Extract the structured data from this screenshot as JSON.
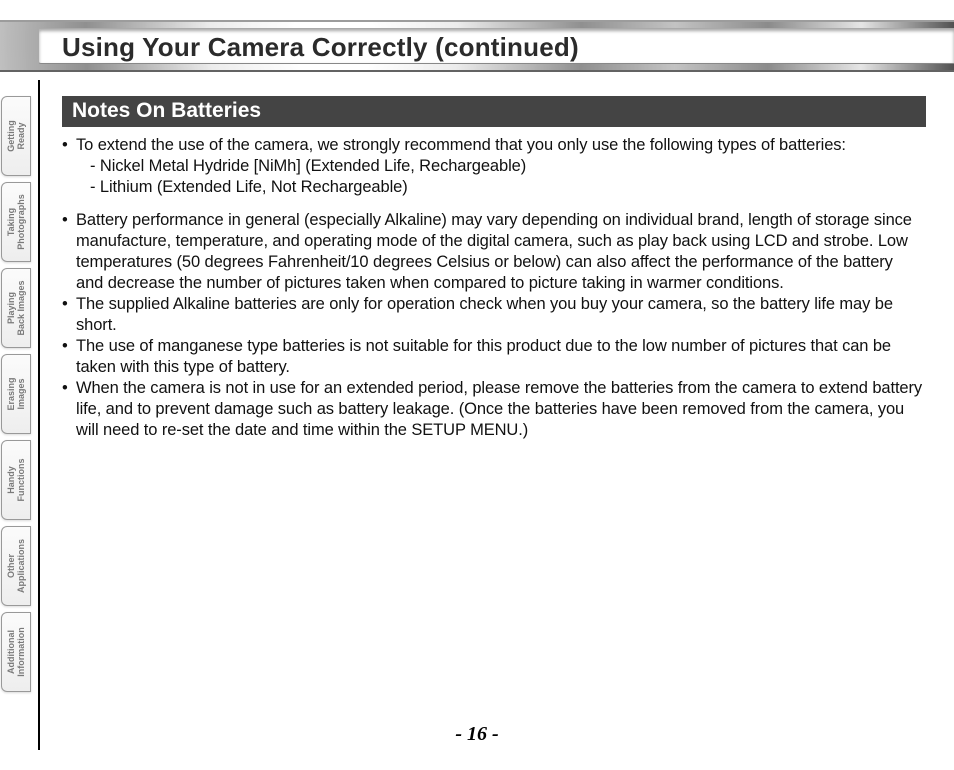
{
  "header": {
    "title": "Using Your Camera Correctly (continued)"
  },
  "sidebar": {
    "tabs": [
      {
        "line1": "Getting",
        "line2": "Ready"
      },
      {
        "line1": "Taking",
        "line2": "Photographs"
      },
      {
        "line1": "Playing",
        "line2": "Back Images"
      },
      {
        "line1": "Erasing",
        "line2": "Images"
      },
      {
        "line1": "Handy",
        "line2": "Functions"
      },
      {
        "line1": "Other",
        "line2": "Applications"
      },
      {
        "line1": "Additional",
        "line2": "Information"
      }
    ]
  },
  "section": {
    "heading": "Notes On Batteries"
  },
  "bullets": [
    {
      "text": "To extend the use of the camera, we strongly recommend that you only use the following types of batteries:",
      "sub": [
        "- Nickel Metal Hydride [NiMh] (Extended Life, Rechargeable)",
        "- Lithium (Extended Life, Not Rechargeable)"
      ]
    },
    {
      "text": "Battery performance in general (especially Alkaline) may vary depending on individual brand, length of storage since manufacture, temperature, and operating mode of the digital camera, such as play back using LCD and strobe. Low temperatures (50 degrees Fahrenheit/10 degrees Celsius or below) can also affect the performance of the battery and decrease the number of pictures taken when compared to picture taking in warmer conditions."
    },
    {
      "text": "The supplied Alkaline batteries are only for operation check when you buy your camera, so the battery life may be short."
    },
    {
      "text": "The use of manganese type batteries is not suitable for this product due to the low number of pictures that can be taken with this type of battery."
    },
    {
      "text": "When the camera is not in use for an extended period, please remove the batteries from the camera to extend battery life, and to prevent damage such as battery leakage. (Once the batteries have been removed from the camera, you will need to re-set the date and time within the SETUP MENU.)"
    }
  ],
  "page_number_display": "- 16 -"
}
